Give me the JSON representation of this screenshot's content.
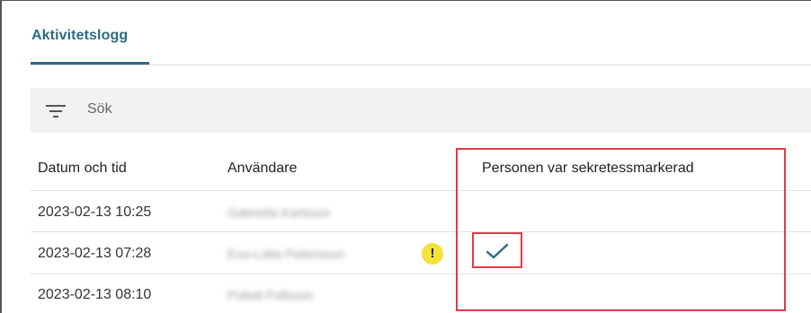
{
  "tabs": [
    {
      "label": "Aktivitetslogg",
      "active": true
    }
  ],
  "search": {
    "placeholder": "Sök",
    "icon": "filter-icon"
  },
  "table": {
    "columns": [
      "Datum och tid",
      "Användare",
      "Personen var sekretessmarkerad"
    ],
    "rows": [
      {
        "datetime": "2023-02-13 10:25",
        "user": "Gabriella Karlsson",
        "warning": false,
        "secret": false
      },
      {
        "datetime": "2023-02-13 07:28",
        "user": "Eva-Lotta Pettersson",
        "warning": true,
        "secret": true
      },
      {
        "datetime": "2023-02-13 08:10",
        "user": "Pollett Pollsson",
        "warning": false,
        "secret": false
      }
    ]
  },
  "warning_badge": {
    "symbol": "!"
  },
  "colors": {
    "accent": "#2c6b82",
    "highlight": "#e53945",
    "warning": "#f2e23a"
  }
}
